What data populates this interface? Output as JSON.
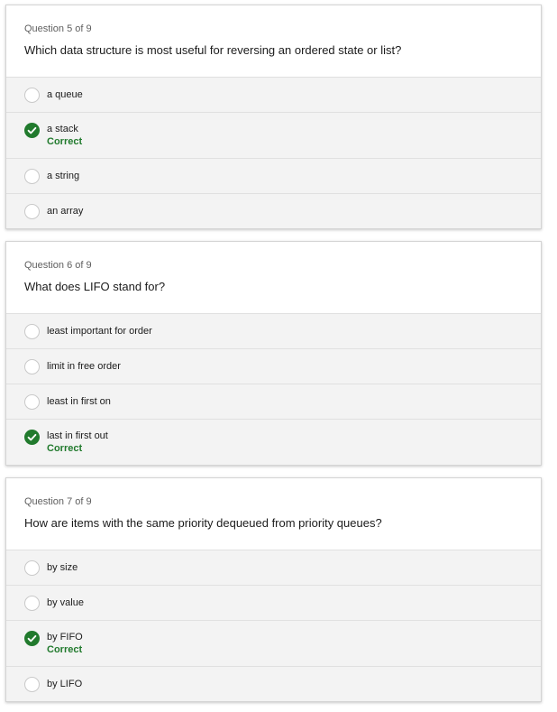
{
  "questions": [
    {
      "number": "Question 5 of 9",
      "text": "Which data structure is most useful for reversing an ordered state or list?",
      "options": [
        {
          "label": "a queue"
        },
        {
          "label": "a stack",
          "result": "Correct"
        },
        {
          "label": "a string"
        },
        {
          "label": "an array"
        }
      ]
    },
    {
      "number": "Question 6 of 9",
      "text": "What does LIFO stand for?",
      "options": [
        {
          "label": "least important for order"
        },
        {
          "label": "limit in free order"
        },
        {
          "label": "least in first on"
        },
        {
          "label": "last in first out",
          "result": "Correct"
        }
      ]
    },
    {
      "number": "Question 7 of 9",
      "text": "How are items with the same priority dequeued from priority queues?",
      "options": [
        {
          "label": "by size"
        },
        {
          "label": "by value"
        },
        {
          "label": "by FIFO",
          "result": "Correct"
        },
        {
          "label": "by LIFO"
        }
      ]
    }
  ],
  "colors": {
    "correct": "#217a2d",
    "option_bg": "#f3f3f3"
  },
  "icons": {
    "selected": "checkmark-circle-icon",
    "unselected": "radio-empty-icon"
  }
}
